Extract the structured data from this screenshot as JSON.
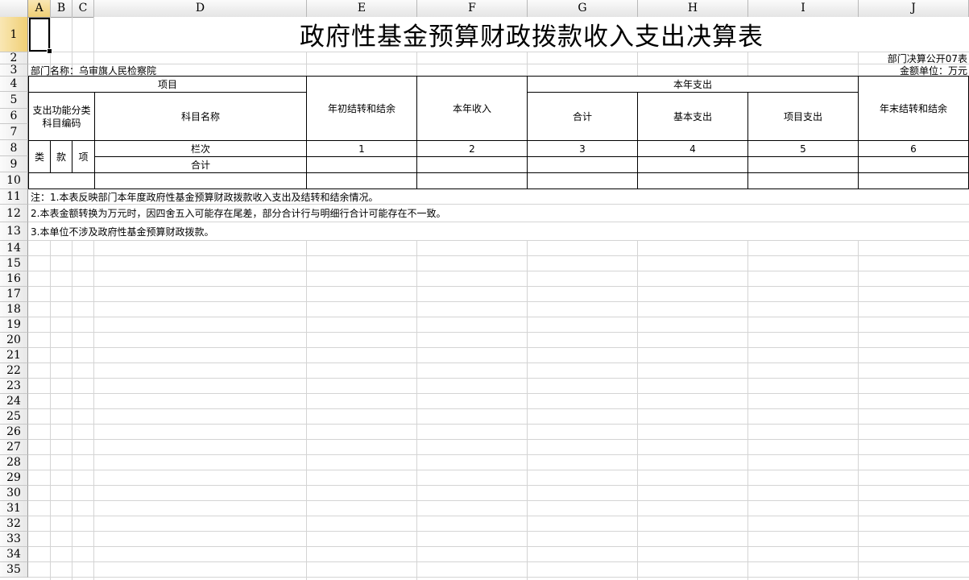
{
  "columns": [
    "A",
    "B",
    "C",
    "D",
    "E",
    "F",
    "G",
    "H",
    "I",
    "J"
  ],
  "rows": [
    "1",
    "2",
    "3",
    "4",
    "5",
    "6",
    "7",
    "8",
    "9",
    "10",
    "11",
    "12",
    "13",
    "14",
    "15",
    "16",
    "17",
    "18",
    "19",
    "20",
    "21",
    "22",
    "23",
    "24",
    "25",
    "26",
    "27",
    "28",
    "29",
    "30",
    "31",
    "32",
    "33",
    "34",
    "35"
  ],
  "title": "政府性基金预算财政拨款收入支出决算表",
  "form_code": "部门决算公开07表",
  "department": "部门名称：乌审旗人民检察院",
  "unit": "金额单位：万元",
  "header": {
    "item": "项目",
    "func_code": "支出功能分类科目编码",
    "subject_name": "科目名称",
    "carry_begin": "年初结转和结余",
    "income": "本年收入",
    "expense": "本年支出",
    "total": "合计",
    "basic": "基本支出",
    "project": "项目支出",
    "carry_end": "年末结转和结余",
    "lei": "类",
    "kuan": "款",
    "xiang": "项",
    "lanci": "栏次",
    "heji": "合计",
    "n1": "1",
    "n2": "2",
    "n3": "3",
    "n4": "4",
    "n5": "5",
    "n6": "6"
  },
  "notes": [
    "注：1.本表反映部门本年度政府性基金预算财政拨款收入支出及结转和结余情况。",
    "2.本表金额转换为万元时，因四舍五入可能存在尾差，部分合计行与明细行合计可能存在不一致。",
    "3.本单位不涉及政府性基金预算财政拨款。"
  ],
  "active_cell": "A1"
}
